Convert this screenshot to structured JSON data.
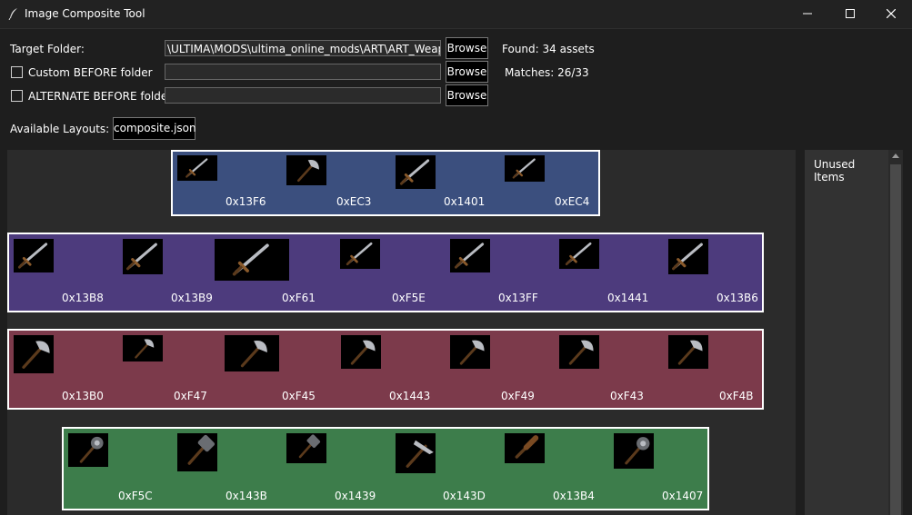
{
  "window": {
    "title": "Image Composite Tool"
  },
  "controls": {
    "target_label": "Target Folder:",
    "target_value": "\\ULTIMA\\MODS\\ultima_online_mods\\ART\\ART_Weapon",
    "custom_label": "Custom BEFORE folder",
    "custom_value": "",
    "alternate_label": "ALTERNATE BEFORE folder",
    "alternate_value": "",
    "browse_label": "Browse",
    "found_text": "Found: 34 assets",
    "matches_text": "Matches: 26/33",
    "layouts_label": "Available Layouts:",
    "layout_value": "composite.json"
  },
  "colors": {
    "blue": "#3b4f7e",
    "purple": "#4d3b7d",
    "red": "#7c3a4b",
    "green": "#3d7d4b"
  },
  "groups": [
    {
      "color": "blue",
      "items": [
        {
          "code": "0x13F6",
          "icon": "dagger-icon"
        },
        {
          "code": "0xEC3",
          "icon": "cleaver-icon"
        },
        {
          "code": "0x1401",
          "icon": "kryss-icon"
        },
        {
          "code": "0xEC4",
          "icon": "skinning-knife-icon"
        }
      ]
    },
    {
      "color": "purple",
      "items": [
        {
          "code": "0x13B8",
          "icon": "sword-icon"
        },
        {
          "code": "0x13B9",
          "icon": "viking-sword-icon"
        },
        {
          "code": "0xF61",
          "icon": "longsword-icon"
        },
        {
          "code": "0xF5E",
          "icon": "broadsword-icon"
        },
        {
          "code": "0x13FF",
          "icon": "katana-icon"
        },
        {
          "code": "0x1441",
          "icon": "cutlass-icon"
        },
        {
          "code": "0x13B6",
          "icon": "scimitar-icon"
        }
      ]
    },
    {
      "color": "red",
      "items": [
        {
          "code": "0x13B0",
          "icon": "war-axe-icon"
        },
        {
          "code": "0xF47",
          "icon": "battle-axe-icon"
        },
        {
          "code": "0xF45",
          "icon": "executioner-axe-icon"
        },
        {
          "code": "0x1443",
          "icon": "two-handed-axe-icon"
        },
        {
          "code": "0xF49",
          "icon": "axe-icon"
        },
        {
          "code": "0xF43",
          "icon": "hatchet-icon"
        },
        {
          "code": "0xF4B",
          "icon": "double-axe-icon"
        }
      ]
    },
    {
      "color": "green",
      "items": [
        {
          "code": "0xF5C",
          "icon": "mace-icon"
        },
        {
          "code": "0x143B",
          "icon": "maul-icon"
        },
        {
          "code": "0x1439",
          "icon": "war-hammer-icon"
        },
        {
          "code": "0x143D",
          "icon": "hammer-pick-icon"
        },
        {
          "code": "0x13B4",
          "icon": "club-icon"
        },
        {
          "code": "0x1407",
          "icon": "war-mace-icon"
        }
      ]
    }
  ],
  "sidebar": {
    "unused_label": "Unused Items"
  }
}
